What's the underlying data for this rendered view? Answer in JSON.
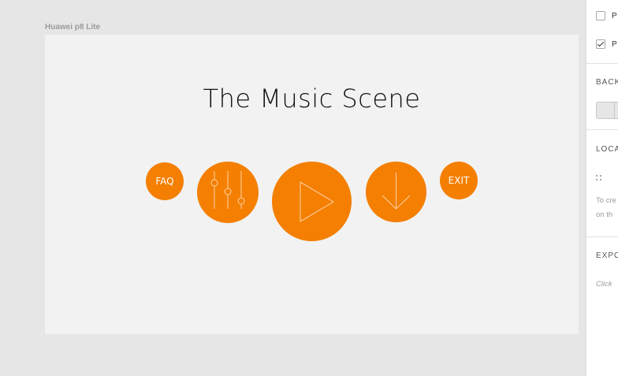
{
  "device_label": "Huawei p8 Lite",
  "screen": {
    "title": "The Music Scene",
    "accent_color": "#f47f00",
    "buttons": {
      "faq": "FAQ",
      "settings_icon": "sliders-icon",
      "play_icon": "play-icon",
      "download_icon": "download-arrow-icon",
      "exit": "EXIT"
    }
  },
  "panel": {
    "checkbox_1": {
      "label": "P",
      "checked": false
    },
    "checkbox_2": {
      "label": "P",
      "checked": true
    },
    "background_title": "BACK",
    "location_title": "LOCA",
    "location_hint_1": "To cre",
    "location_hint_2": "on th",
    "export_title": "EXPO",
    "export_hint": "Click"
  }
}
